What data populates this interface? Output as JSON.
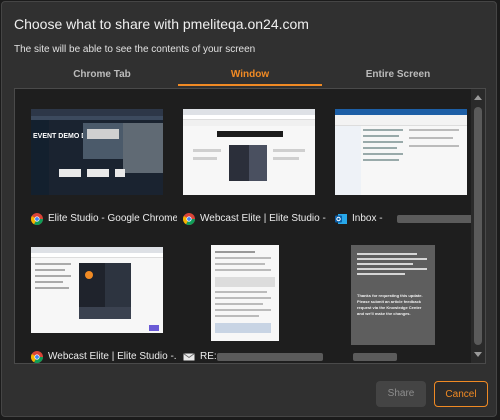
{
  "dialog": {
    "title": "Choose what to share with pmeliteqa.on24.com",
    "subtitle": "The site will be able to see the contents of your screen"
  },
  "tabs": [
    {
      "label": "Chrome Tab"
    },
    {
      "label": "Window",
      "selected": true
    },
    {
      "label": "Entire Screen"
    }
  ],
  "windows": [
    {
      "title": "Elite Studio - Google Chrome",
      "icon": "chrome-icon"
    },
    {
      "title": "Webcast Elite | Elite Studio - I...",
      "icon": "chrome-icon"
    },
    {
      "title": "Inbox -",
      "icon": "outlook-icon"
    },
    {
      "title": "Webcast Elite | Elite Studio -...",
      "icon": "chrome-icon"
    },
    {
      "title": "RE:",
      "icon": "email-icon"
    },
    {
      "title": "",
      "icon": "window-icon"
    }
  ],
  "thumbnail_text": {
    "event_demo": "EVENT DEMO D",
    "doc_lines": [
      "Thanks for requesting this update.",
      "Please submit an article feedback",
      "request via the Knowledge Center",
      "and we'll make the changes."
    ]
  },
  "buttons": {
    "share": "Share",
    "cancel": "Cancel"
  },
  "colors": {
    "accent": "#f08a24",
    "dialog_bg": "#303030",
    "grid_bg": "#1e1e1e"
  }
}
